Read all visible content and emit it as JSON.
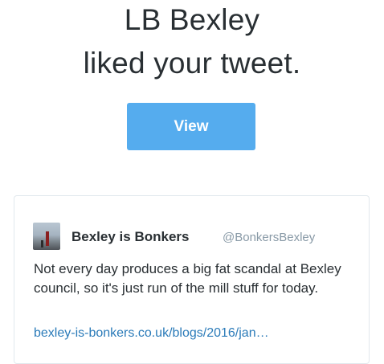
{
  "notification": {
    "actor": "LB Bexley",
    "action": "liked your tweet."
  },
  "view_button": {
    "label": "View",
    "color": "#55acee"
  },
  "tweet": {
    "author_name": "Bexley is Bonkers",
    "author_handle": "@BonkersBexley",
    "avatar_icon": "profile-photo-icon",
    "text": "Not every day produces a big fat scandal at Bexley council, so it's just run of the mill stuff for today.",
    "link": "bexley-is-bonkers.co.uk/blogs/2016/jan…",
    "link_color": "#2b7bb9"
  }
}
